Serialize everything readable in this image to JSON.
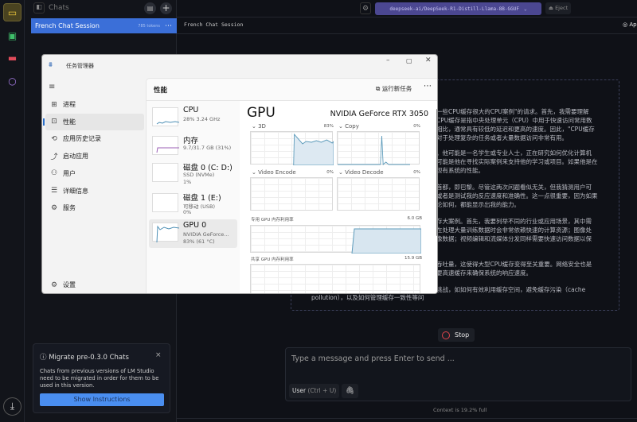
{
  "sidebar": {
    "header": "Chats",
    "active_chat": {
      "title": "French Chat Session",
      "tokens": "785 tokens"
    }
  },
  "topbar": {
    "model": "deepseek-ai/DeepSeek-R1-Distill-Llama-8B-GGUF",
    "eject": "Eject",
    "chat_title": "French Chat Session",
    "right_label": "Ap"
  },
  "message": {
    "lines": [
      "一些CPU缓存很大的CPU案例\"的请求。首先，我需要理解",
      "CPU缓存是指中央处理单元（CPU）中用于快速访问常用数",
      "相比，通常具有较低的延迟和更高的速度。因此，\"CPU缓存",
      "对于处理复杂的任务或者大量数据访问非常有用。",
      "。他可能是一名学生或专业人士，正在研究如何优化计算机",
      "可能是他在寻找实际案例来支持他的学习或项目。如果他是在",
      "现有系统的性能。",
      "首都，即巴黎。尽管这两次问题看似无关，但我猜测用户可",
      "或者是测试我的反应速度和准确性。这一点很重要，因为如果",
      "论如何，都能显示出我的能力。",
      "存大案例。首先，我要列举不同的行业或应用场景，其中需",
      "在处理大量训练数据时会非常依赖快速的计算资源；图像处",
      "像数据；视频编辑和流媒体分发同样需要快速访问数据以保",
      "吞吐量，这使得大型CPU缓存变得至关重要。网络安全也是",
      "要高速缓存来确保系统的响应速度。",
      "挑战，如如何有效利用缓存空间，避免缓存污染（cache"
    ],
    "last_line": "pollution），以及如何管理缓存一致性等问"
  },
  "stop_label": "Stop",
  "input": {
    "placeholder": "Type a message and press Enter to send ...",
    "role": "User",
    "role_shortcut": "(Ctrl + U)"
  },
  "context_status": "Context is 19.2% full",
  "migrate": {
    "title": "Migrate pre-0.3.0 Chats",
    "body": "Chats from previous versions of LM Studio need to be migrated in order for them to be used in this version.",
    "button": "Show Instructions"
  },
  "taskmgr": {
    "title": "任务管理器",
    "section": "性能",
    "run_task": "运行新任务",
    "nav": [
      "进程",
      "性能",
      "应用历史记录",
      "启动应用",
      "用户",
      "详细信息",
      "服务"
    ],
    "settings": "设置",
    "devices": [
      {
        "name": "CPU",
        "sub1": "28% 3.24 GHz",
        "sub2": ""
      },
      {
        "name": "内存",
        "sub1": "9.7/31.7 GB (31%)",
        "sub2": ""
      },
      {
        "name": "磁盘 0 (C: D:)",
        "sub1": "SSD (NVMe)",
        "sub2": "1%"
      },
      {
        "name": "磁盘 1 (E:)",
        "sub1": "可移动 (USB)",
        "sub2": "0%"
      },
      {
        "name": "GPU 0",
        "sub1": "NVIDIA GeForce...",
        "sub2": "83% (61 °C)"
      }
    ],
    "gpu": {
      "title": "GPU",
      "model": "NVIDIA GeForce RTX 3050",
      "engines": [
        {
          "name": "3D",
          "value": "83%"
        },
        {
          "name": "Copy",
          "value": "0%"
        },
        {
          "name": "Video Encode",
          "value": "0%"
        },
        {
          "name": "Video Decode",
          "value": "0%"
        }
      ],
      "dedicated": {
        "label": "专用 GPU 内存利用率",
        "value": "6.0 GB"
      },
      "shared": {
        "label": "共享 GPU 内存利用率",
        "value": "15.9 GB"
      }
    }
  },
  "colors": {
    "accent": "#3b6fd8",
    "model_bg": "#4b4791",
    "stop": "#e0444c",
    "button": "#4a8ef0"
  }
}
